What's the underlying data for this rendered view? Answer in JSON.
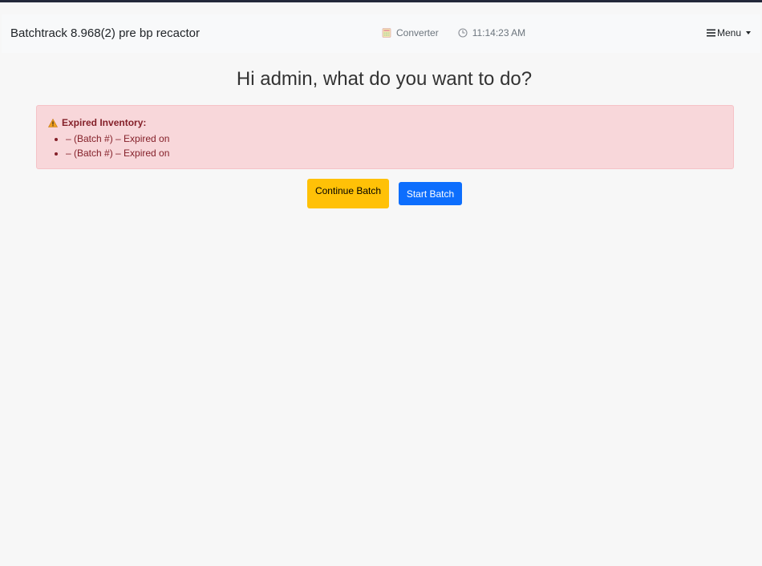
{
  "navbar": {
    "brand": "Batchtrack 8.968(2) pre bp recactor",
    "converter_label": "Converter",
    "clock_time": "11:14:23 AM",
    "menu_label": "Menu"
  },
  "main": {
    "heading": "Hi admin, what do you want to do?"
  },
  "alert": {
    "title": "Expired Inventory:",
    "items": [
      {
        "text": "– (Batch #) – Expired on"
      },
      {
        "text": "– (Batch #) – Expired on"
      }
    ]
  },
  "actions": {
    "continue_label": "Continue Batch",
    "start_label": "Start Batch"
  },
  "colors": {
    "alert_bg": "#f8d7da",
    "alert_text": "#842029",
    "continue_bg": "#ffc107",
    "start_bg": "#0d6efd",
    "page_bg": "#f7f7f7"
  }
}
